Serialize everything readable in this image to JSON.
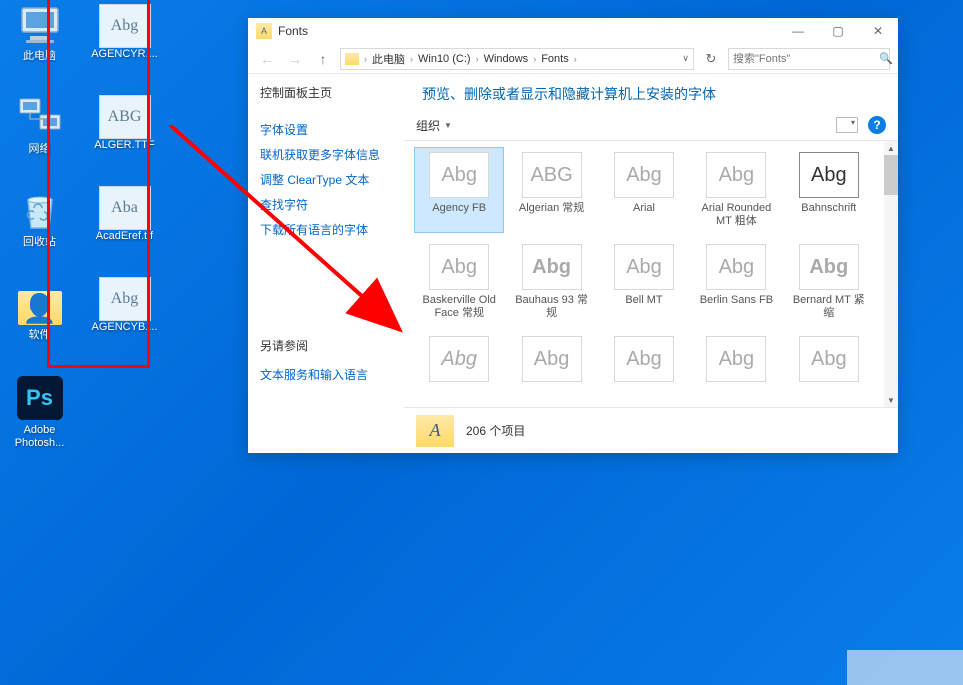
{
  "desktop": {
    "col1": [
      {
        "name": "this-pc",
        "label": "此电脑"
      },
      {
        "name": "network",
        "label": "网络"
      },
      {
        "name": "recycle-bin",
        "label": "回收站"
      },
      {
        "name": "software-folder",
        "label": "软件"
      },
      {
        "name": "photoshop",
        "label": "Adobe Photosh..."
      }
    ],
    "col2": [
      {
        "name": "agencyr",
        "glyph": "Abg",
        "label": "AGENCYR...."
      },
      {
        "name": "alger",
        "glyph": "ABG",
        "label": "ALGER.TTF"
      },
      {
        "name": "acaderef",
        "glyph": "Aba",
        "label": "AcadEref.ttf"
      },
      {
        "name": "agencyb",
        "glyph": "Abg",
        "label": "AGENCYB...."
      }
    ]
  },
  "window": {
    "title": "Fonts",
    "breadcrumb": [
      "此电脑",
      "Win10 (C:)",
      "Windows",
      "Fonts"
    ],
    "search_placeholder": "搜索\"Fonts\"",
    "heading": "预览、删除或者显示和隐藏计算机上安装的字体",
    "organize": "组织",
    "sidebar": {
      "main_heading": "控制面板主页",
      "links": [
        "字体设置",
        "联机获取更多字体信息",
        "调整 ClearType 文本",
        "查找字符",
        "下载所有语言的字体"
      ],
      "see_also_heading": "另请参阅",
      "see_also_links": [
        "文本服务和输入语言"
      ]
    },
    "fonts": [
      {
        "glyph": "Abg",
        "label": "Agency FB",
        "selected": true,
        "stack": true
      },
      {
        "glyph": "ABG",
        "label": "Algerian 常规",
        "stack": false
      },
      {
        "glyph": "Abg",
        "label": "Arial",
        "stack": true
      },
      {
        "glyph": "Abg",
        "label": "Arial Rounded MT 粗体",
        "stack": false
      },
      {
        "glyph": "Abg",
        "label": "Bahnschrift",
        "stack": false,
        "special": "bahnschrift"
      },
      {
        "glyph": "Abg",
        "label": "Baskerville Old Face 常规",
        "stack": false
      },
      {
        "glyph": "Abg",
        "label": "Bauhaus 93 常规",
        "stack": false,
        "weight": "bold"
      },
      {
        "glyph": "Abg",
        "label": "Bell MT",
        "stack": true
      },
      {
        "glyph": "Abg",
        "label": "Berlin Sans FB",
        "stack": true
      },
      {
        "glyph": "Abg",
        "label": "Bernard MT 紧缩",
        "stack": false,
        "weight": "bold"
      },
      {
        "glyph": "Abg",
        "label": "",
        "stack": false,
        "style": "italic"
      },
      {
        "glyph": "Abg",
        "label": "",
        "stack": true
      },
      {
        "glyph": "Abg",
        "label": "",
        "stack": true
      },
      {
        "glyph": "Abg",
        "label": "",
        "stack": false
      },
      {
        "glyph": "Abg",
        "label": "",
        "stack": false
      }
    ],
    "status_count": "206 个项目"
  }
}
